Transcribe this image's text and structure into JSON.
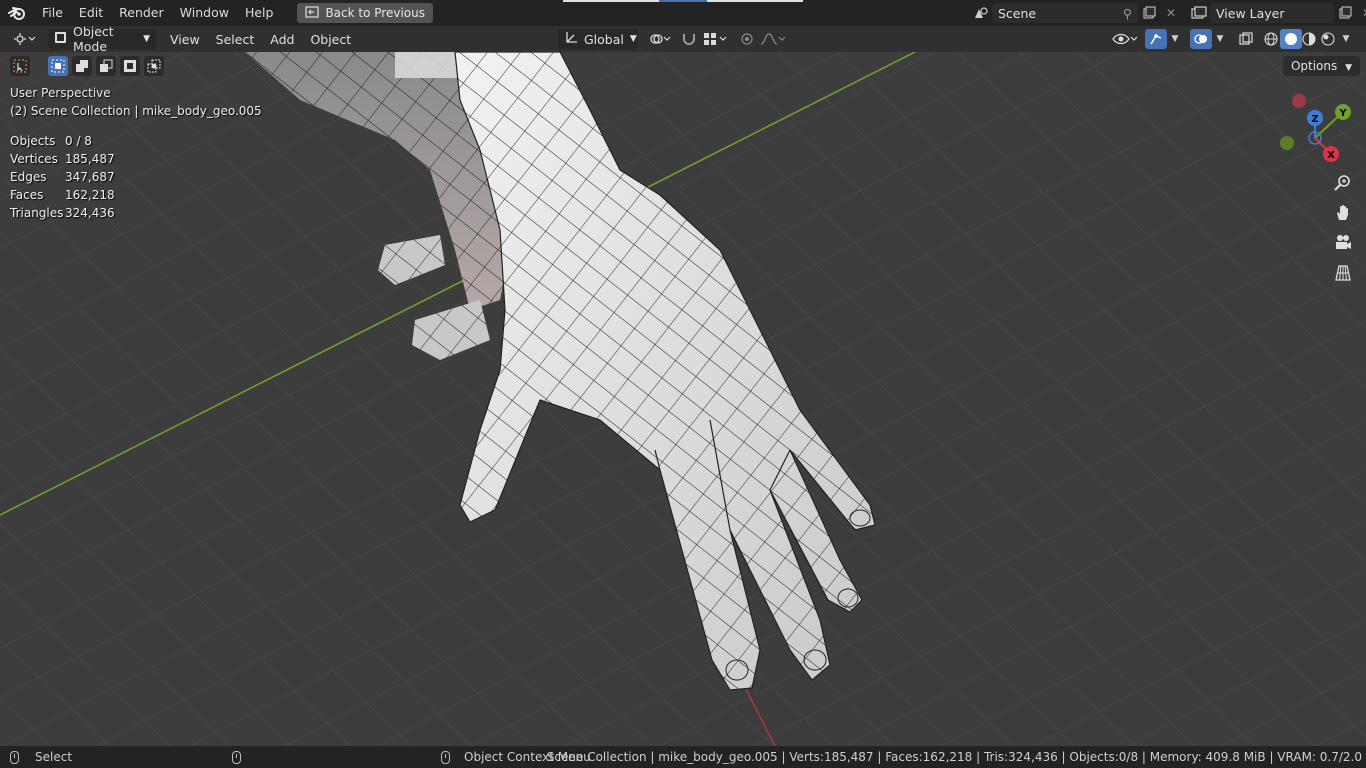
{
  "menu": {
    "items": [
      "File",
      "Edit",
      "Render",
      "Window",
      "Help"
    ],
    "back_button": "Back to Previous",
    "scene_name": "Scene",
    "view_layer": "View Layer"
  },
  "header": {
    "mode": "Object Mode",
    "menus": [
      "View",
      "Select",
      "Add",
      "Object"
    ],
    "transform_orientation": "Global",
    "options_label": "Options"
  },
  "viewport": {
    "perspective": "User Perspective",
    "collection": "(2) Scene Collection | mike_body_geo.005",
    "stats": [
      {
        "label": "Objects",
        "value": "0 / 8"
      },
      {
        "label": "Vertices",
        "value": "185,487"
      },
      {
        "label": "Edges",
        "value": "347,687"
      },
      {
        "label": "Faces",
        "value": "162,218"
      },
      {
        "label": "Triangles",
        "value": "324,436"
      }
    ],
    "gizmo": {
      "z": "Z",
      "y": "Y",
      "x": "X"
    }
  },
  "statusbar": {
    "select": "Select",
    "context_menu": "Object Context Menu",
    "info": "Scene Collection | mike_body_geo.005 | Verts:185,487 | Faces:162,218 | Tris:324,436 | Objects:0/8 | Memory: 409.8 MiB | VRAM: 0.7/2.0"
  },
  "colors": {
    "accent": "#4772b3",
    "x_axis": "#d9344a",
    "y_axis": "#6ea02a",
    "z_axis": "#3d7fd6"
  }
}
